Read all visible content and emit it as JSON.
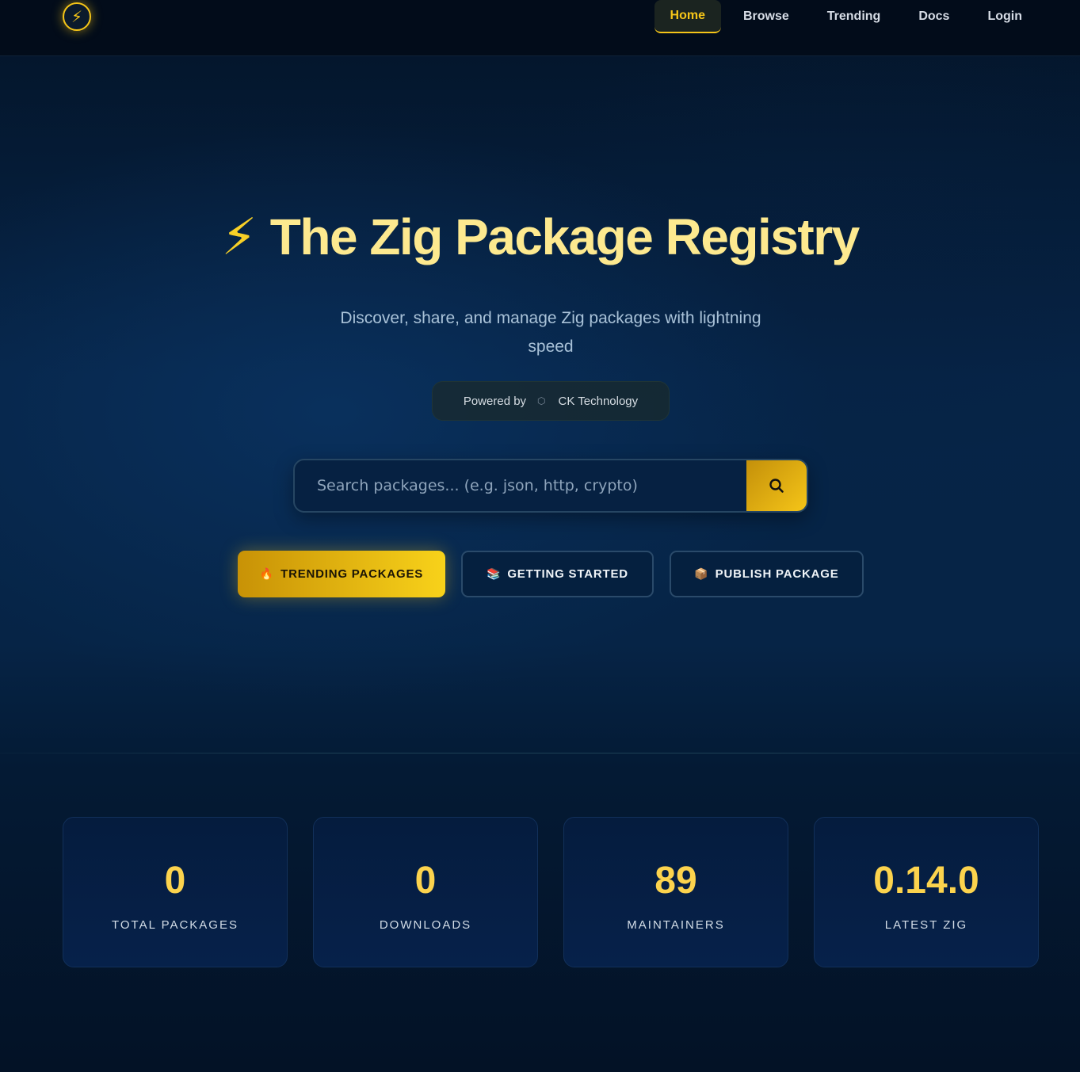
{
  "header": {
    "logo_icon": "lightning-bolt-icon",
    "nav": [
      {
        "label": "Home",
        "active": true
      },
      {
        "label": "Browse",
        "active": false
      },
      {
        "label": "Trending",
        "active": false
      },
      {
        "label": "Docs",
        "active": false
      },
      {
        "label": "Login",
        "active": false
      }
    ]
  },
  "hero": {
    "bolt": "⚡",
    "title": "The Zig Package Registry",
    "subtitle": "Discover, share, and manage Zig packages with lightning speed",
    "powered_by_label": "Powered by",
    "powered_by_name": "CK Technology"
  },
  "search": {
    "placeholder": "Search packages... (e.g. json, http, crypto)",
    "value": "",
    "button_icon": "search-icon"
  },
  "actions": {
    "trending": {
      "emoji": "🔥",
      "label": "Trending Packages"
    },
    "getting_started": {
      "emoji": "📚",
      "label": "Getting Started"
    },
    "publish": {
      "emoji": "📦",
      "label": "Publish Package"
    }
  },
  "stats": [
    {
      "value": "0",
      "label": "Total Packages"
    },
    {
      "value": "0",
      "label": "Downloads"
    },
    {
      "value": "89",
      "label": "Maintainers"
    },
    {
      "value": "0.14.0",
      "label": "Latest Zig"
    }
  ],
  "colors": {
    "accent": "#f5c518",
    "title": "#fde98f",
    "background": "#041a34"
  }
}
